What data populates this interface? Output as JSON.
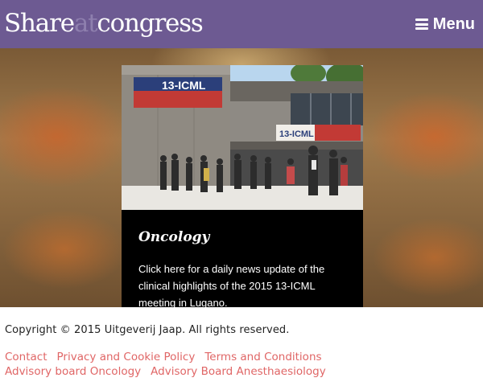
{
  "header": {
    "logo_part1": "Share",
    "logo_part2": "at",
    "logo_part3": "congress",
    "menu_label": "Menu",
    "bg_color": "#6d5a92",
    "logo_at_color": "#8e7fae",
    "menu_icon": "hamburger-icon"
  },
  "card": {
    "photo_icon": "congress-venue-photo",
    "photo_banner_text": "13-ICML",
    "title": "Oncology",
    "description": "Click here for a daily news update of the clinical highlights of the 2015 13-ICML meeting in Lugano."
  },
  "footer": {
    "copyright": "Copyright © 2015 Uitgeverij Jaap. All rights reserved.",
    "link_color": "#e06666",
    "links_row1": [
      "Contact",
      "Privacy and Cookie Policy",
      "Terms and Conditions"
    ],
    "links_row2": [
      "Advisory board Oncology",
      "Advisory Board Anesthaesiology"
    ]
  }
}
